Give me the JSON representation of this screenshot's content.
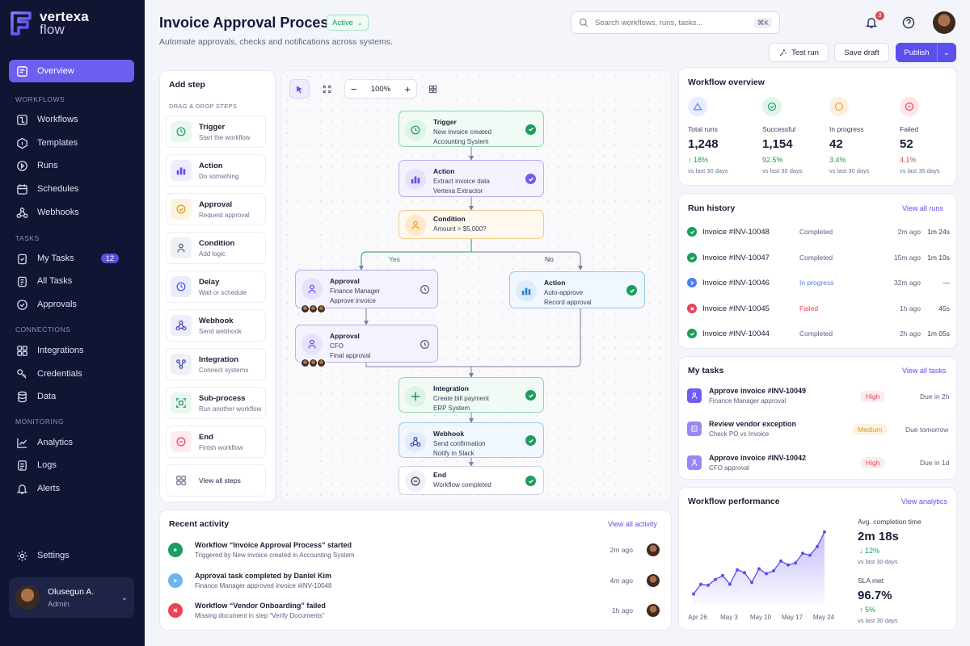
{
  "brand": {
    "name": "vertexa",
    "sub": "flow",
    "accent": "#6d5ef0"
  },
  "sidebar": {
    "overview": "Overview",
    "sections": {
      "workflows": "WORKFLOWS",
      "tasks": "TASKS",
      "connections": "CONNECTIONS",
      "monitoring": "MONITORING"
    },
    "workflows": [
      "Workflows",
      "Templates",
      "Runs",
      "Schedules",
      "Webhooks"
    ],
    "tasks": [
      "My Tasks",
      "All Tasks",
      "Approvals"
    ],
    "my_tasks_badge": "12",
    "connections": [
      "Integrations",
      "Credentials",
      "Data"
    ],
    "monitoring": [
      "Analytics",
      "Logs",
      "Alerts"
    ],
    "settings": "Settings",
    "user": {
      "name": "Olusegun A.",
      "role": "Admin"
    }
  },
  "header": {
    "title": "Invoice Approval Process",
    "status": "Active",
    "subtitle": "Automate approvals, checks and notifications across systems.",
    "search_placeholder": "Search workflows, runs, tasks...",
    "search_shortcut": "⌘K",
    "notif_count": "3",
    "test_run": "Test run",
    "save_draft": "Save draft",
    "publish": "Publish"
  },
  "steps_panel": {
    "title": "Add step",
    "subtitle": "DRAG & DROP STEPS",
    "steps": [
      {
        "title": "Trigger",
        "desc": "Start the workflow"
      },
      {
        "title": "Action",
        "desc": "Do something"
      },
      {
        "title": "Approval",
        "desc": "Request approval"
      },
      {
        "title": "Condition",
        "desc": "Add logic"
      },
      {
        "title": "Delay",
        "desc": "Wait or schedule"
      },
      {
        "title": "Webhook",
        "desc": "Send webhook"
      },
      {
        "title": "Integration",
        "desc": "Connect systems"
      },
      {
        "title": "Sub-process",
        "desc": "Run another workflow"
      },
      {
        "title": "End",
        "desc": "Finish workflow"
      }
    ],
    "view_all": "View all steps"
  },
  "canvas": {
    "zoom": "100%",
    "yes": "Yes",
    "no": "No",
    "nodes": {
      "trigger": {
        "title": "Trigger",
        "l1": "New invoice created",
        "l2": "Accounting System"
      },
      "action": {
        "title": "Action",
        "l1": "Extract invoice data",
        "l2": "Vertexa Extractor"
      },
      "condition": {
        "title": "Condition",
        "l1": "Amount > $5,000?"
      },
      "approval1": {
        "title": "Approval",
        "l1": "Finance Manager",
        "l2": "Approve invoice"
      },
      "autoapprove": {
        "title": "Action",
        "l1": "Auto-approve",
        "l2": "Record approval"
      },
      "approval2": {
        "title": "Approval",
        "l1": "CFO",
        "l2": "Final approval"
      },
      "integration": {
        "title": "Integration",
        "l1": "Create bill payment",
        "l2": "ERP System"
      },
      "webhook": {
        "title": "Webhook",
        "l1": "Send confirmation",
        "l2": "Notify in Slack"
      },
      "end": {
        "title": "End",
        "l1": "Workflow completed"
      }
    }
  },
  "overview": {
    "title": "Workflow overview",
    "metrics": [
      {
        "label": "Total runs",
        "value": "1,248",
        "change": "↑ 18%",
        "sub": "vs last 30 days",
        "color": "#4f7df0"
      },
      {
        "label": "Successful",
        "value": "1,154",
        "change": "92.5%",
        "sub": "vs last 30 days",
        "color": "#1c9c5e"
      },
      {
        "label": "In progress",
        "value": "42",
        "change": "3.4%",
        "sub": "vs last 30 days",
        "color": "#f0a230"
      },
      {
        "label": "Failed",
        "value": "52",
        "change": "4.1%",
        "sub": "vs last 30 days",
        "color": "#e8435a"
      }
    ]
  },
  "run_history": {
    "title": "Run history",
    "link": "View all runs",
    "rows": [
      {
        "id": "Invoice #INV-10048",
        "status": "Completed",
        "ago": "2m ago",
        "dur": "1m 24s",
        "kind": "ok"
      },
      {
        "id": "Invoice #INV-10047",
        "status": "Completed",
        "ago": "15m ago",
        "dur": "1m 10s",
        "kind": "ok"
      },
      {
        "id": "Invoice #INV-10046",
        "status": "In progress",
        "ago": "32m ago",
        "dur": "—",
        "kind": "prog"
      },
      {
        "id": "Invoice #INV-10045",
        "status": "Failed",
        "ago": "1h ago",
        "dur": "45s",
        "kind": "fail"
      },
      {
        "id": "Invoice #INV-10044",
        "status": "Completed",
        "ago": "2h ago",
        "dur": "1m 05s",
        "kind": "ok"
      }
    ]
  },
  "my_tasks": {
    "title": "My tasks",
    "link": "View all tasks",
    "rows": [
      {
        "title": "Approve invoice #INV-10049",
        "sub": "Finance Manager approval",
        "prio": "High",
        "due": "Due in 2h"
      },
      {
        "title": "Review vendor exception",
        "sub": "Check PO vs Invoice",
        "prio": "Medium",
        "due": "Due tomorrow"
      },
      {
        "title": "Approve invoice #INV-10042",
        "sub": "CFO approval",
        "prio": "High",
        "due": "Due in 1d"
      }
    ]
  },
  "activity": {
    "title": "Recent activity",
    "link": "View all activity",
    "rows": [
      {
        "title": "Workflow “Invoice Approval Process” started",
        "sub": "Triggered by New invoice created in Accounting System",
        "ago": "2m ago"
      },
      {
        "title": "Approval task completed by Daniel Kim",
        "sub": "Finance Manager approved invoice #INV-10048",
        "ago": "4m ago"
      },
      {
        "title": "Workflow “Vendor Onboarding” failed",
        "sub": "Missing document in step “Verify Documents”",
        "ago": "1h ago"
      }
    ]
  },
  "performance": {
    "title": "Workflow performance",
    "link": "View analytics",
    "avg_label": "Avg. completion time",
    "avg_value": "2m 18s",
    "avg_change": "↓ 12%",
    "avg_sub": "vs last 30 days",
    "sla_label": "SLA met",
    "sla_value": "96.7%",
    "sla_change": "↑ 5%",
    "sla_sub": "vs last 30 days",
    "chart_data": {
      "type": "area",
      "categories": [
        "Apr 26",
        "May 3",
        "May 10",
        "May 17",
        "May 24"
      ],
      "values": [
        12,
        22,
        21,
        27,
        31,
        22,
        37,
        34,
        24,
        38,
        33,
        36,
        46,
        42,
        44,
        54,
        52,
        61,
        76
      ],
      "ylim": [
        0,
        85
      ]
    }
  }
}
